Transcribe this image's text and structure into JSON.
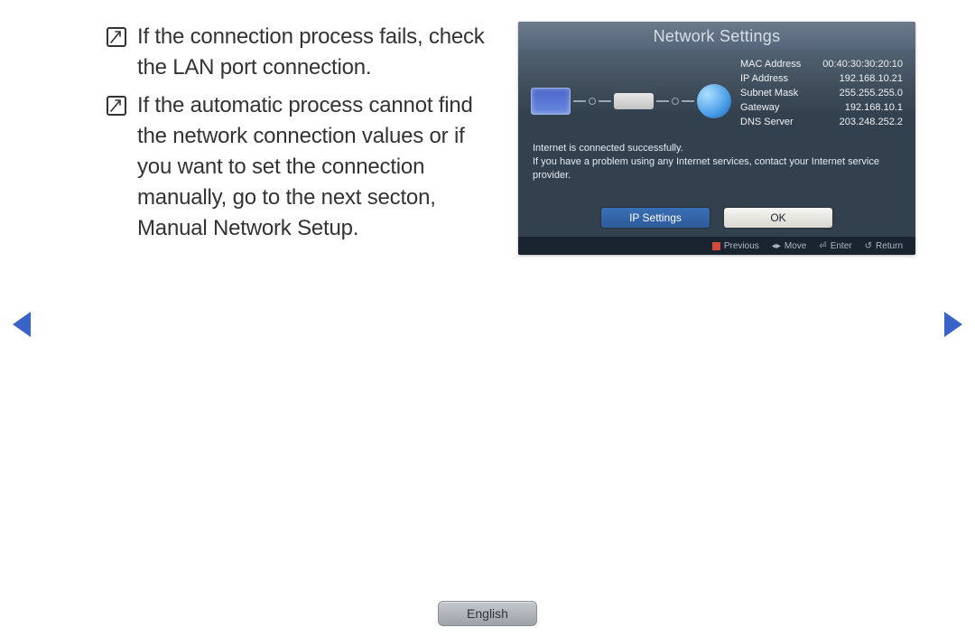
{
  "notes": [
    "If the connection process fails, check the LAN port connection.",
    "If the automatic process cannot find the network connection values or if you want to set the connection manually, go to the next secton, Manual Network Setup."
  ],
  "screenshot": {
    "title": "Network Settings",
    "info": [
      {
        "label": "MAC Address",
        "value": "00:40:30:30:20:10"
      },
      {
        "label": "IP Address",
        "value": "192.168.10.21"
      },
      {
        "label": "Subnet Mask",
        "value": "255.255.255.0"
      },
      {
        "label": "Gateway",
        "value": "192.168.10.1"
      },
      {
        "label": "DNS Server",
        "value": "203.248.252.2"
      }
    ],
    "status_line1": "Internet is connected successfully.",
    "status_line2": "If you have a problem using any Internet services, contact your Internet service provider.",
    "buttons": {
      "ip": "IP Settings",
      "ok": "OK"
    },
    "legend": {
      "previous": "Previous",
      "move": "Move",
      "enter": "Enter",
      "return": "Return"
    }
  },
  "language_button": "English"
}
